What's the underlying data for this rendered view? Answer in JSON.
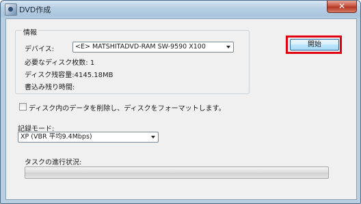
{
  "window": {
    "title": "DVD作成",
    "close_glyph": "✕"
  },
  "info": {
    "group_title": "情報",
    "device_label": "デバイス:",
    "device_value": "<E>  MATSHITADVD-RAM SW-9590  X100",
    "discs_needed": "必要なディスク枚数: 1",
    "remaining_capacity": "ディスク残容量:4145.18MB",
    "write_time": "書込み残り時間:"
  },
  "start_button": {
    "label": "開始",
    "highlight_color": "#e00012"
  },
  "format_checkbox": {
    "label": "ディスク内のデータを削除し、ディスクをフォーマットします。",
    "checked": false
  },
  "record_mode": {
    "label": "記録モード:",
    "value": "XP (VBR 平均9.4Mbps)"
  },
  "task_progress": {
    "label": "タスクの進行状況:",
    "fraction": 0
  }
}
